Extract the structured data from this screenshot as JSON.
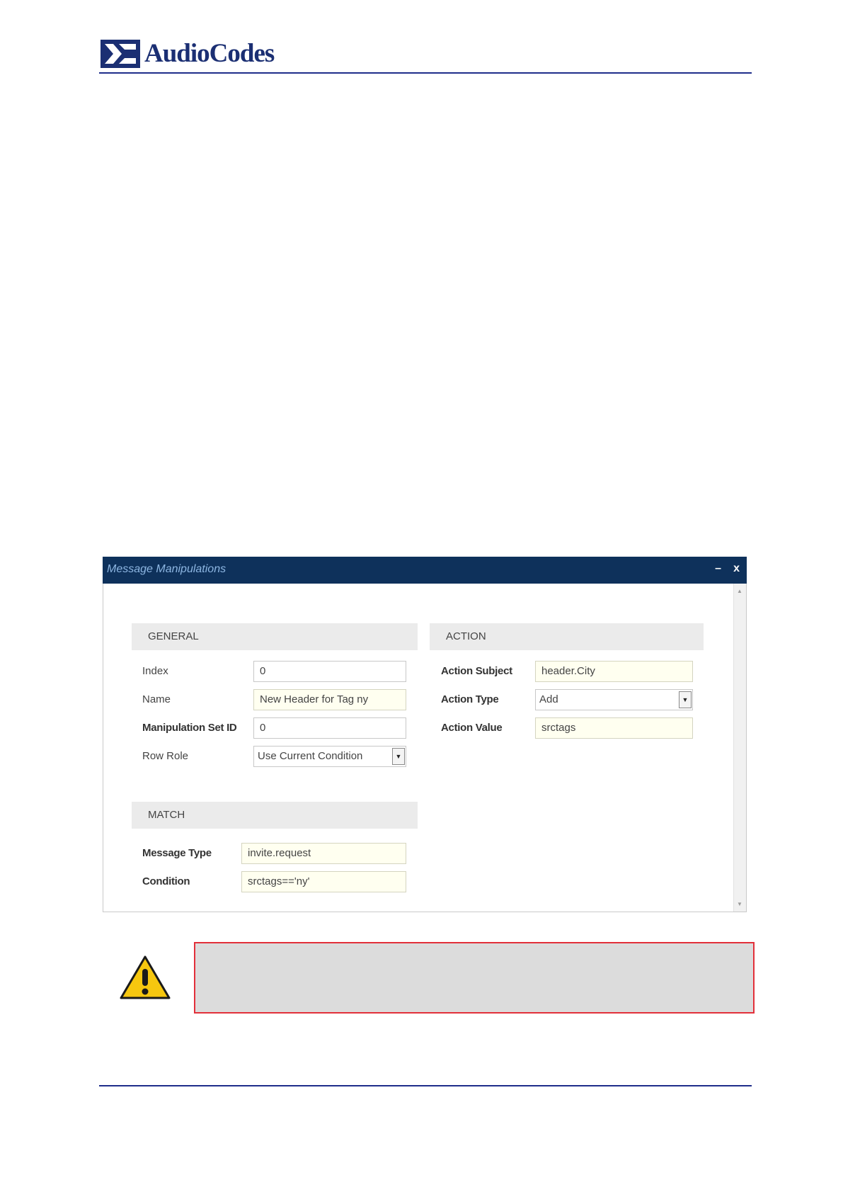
{
  "header": {
    "brand": "AudioCodes"
  },
  "dialog": {
    "title": "Message Manipulations",
    "minimize_glyph": "–",
    "close_glyph": "x",
    "general": {
      "heading": "GENERAL",
      "fields": [
        {
          "label": "Index",
          "value": "0"
        },
        {
          "label": "Name",
          "value": "New Header for Tag ny"
        },
        {
          "label": "Manipulation Set ID",
          "value": "0"
        },
        {
          "label": "Row Role",
          "value": "Use Current Condition"
        }
      ]
    },
    "match": {
      "heading": "MATCH",
      "fields": [
        {
          "label": "Message Type",
          "value": "invite.request"
        },
        {
          "label": "Condition",
          "value": "srctags=='ny'"
        }
      ]
    },
    "action": {
      "heading": "ACTION",
      "fields": [
        {
          "label": "Action Subject",
          "value": "header.City"
        },
        {
          "label": "Action Type",
          "value": "Add"
        },
        {
          "label": "Action Value",
          "value": "srctags"
        }
      ]
    }
  },
  "colors": {
    "titlebar": "#0e315b",
    "rule": "#1f2d8a",
    "note_border": "#e2303a",
    "note_fill": "#dcdcdc",
    "highlight_field": "#fffff0"
  },
  "icons": [
    "audiocodes-logo-icon",
    "minimize-icon",
    "close-icon",
    "dropdown-arrow-icon",
    "warning-icon"
  ]
}
